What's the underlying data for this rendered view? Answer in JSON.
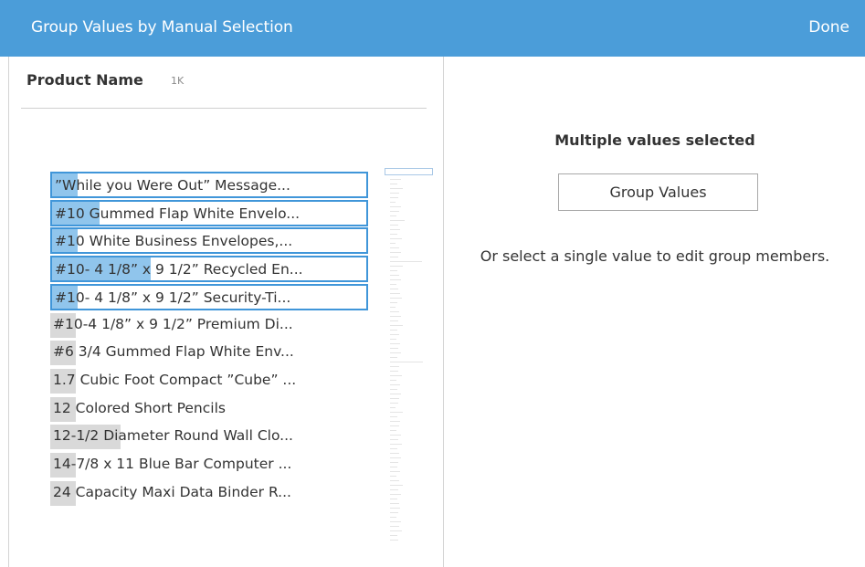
{
  "header": {
    "title": "Group Values by Manual Selection",
    "done_label": "Done"
  },
  "field": {
    "name": "Product Name",
    "count": "1K"
  },
  "values": [
    {
      "label": "”While you Were Out” Message...",
      "selected": true,
      "bar_fraction": 0.08
    },
    {
      "label": "#10 Gummed Flap White Envelo...",
      "selected": true,
      "bar_fraction": 0.15
    },
    {
      "label": "#10 White Business Envelopes,...",
      "selected": true,
      "bar_fraction": 0.08
    },
    {
      "label": "#10- 4 1/8” x 9 1/2” Recycled En...",
      "selected": true,
      "bar_fraction": 0.31
    },
    {
      "label": "#10- 4 1/8” x 9 1/2” Security-Ti...",
      "selected": true,
      "bar_fraction": 0.08
    },
    {
      "label": "#10-4 1/8” x 9 1/2” Premium Di...",
      "selected": false,
      "bar_fraction": 0.08
    },
    {
      "label": "#6 3/4 Gummed Flap White Env...",
      "selected": false,
      "bar_fraction": 0.08
    },
    {
      "label": "1.7 Cubic Foot Compact ”Cube” ...",
      "selected": false,
      "bar_fraction": 0.08
    },
    {
      "label": "12 Colored Short Pencils",
      "selected": false,
      "bar_fraction": 0.08
    },
    {
      "label": "12-1/2 Diameter Round Wall Clo...",
      "selected": false,
      "bar_fraction": 0.22
    },
    {
      "label": "14-7/8 x 11 Blue Bar Computer ...",
      "selected": false,
      "bar_fraction": 0.08
    },
    {
      "label": "24 Capacity Maxi Data Binder R...",
      "selected": false,
      "bar_fraction": 0.08
    }
  ],
  "detail": {
    "message": "Multiple values selected",
    "group_button": "Group Values",
    "hint": "Or select a single value to edit group members."
  },
  "colors": {
    "header_bg": "#4b9dd9",
    "selection_border": "#4096d9",
    "selected_bar": "#90c5ec",
    "bar": "#d9d9d9"
  }
}
